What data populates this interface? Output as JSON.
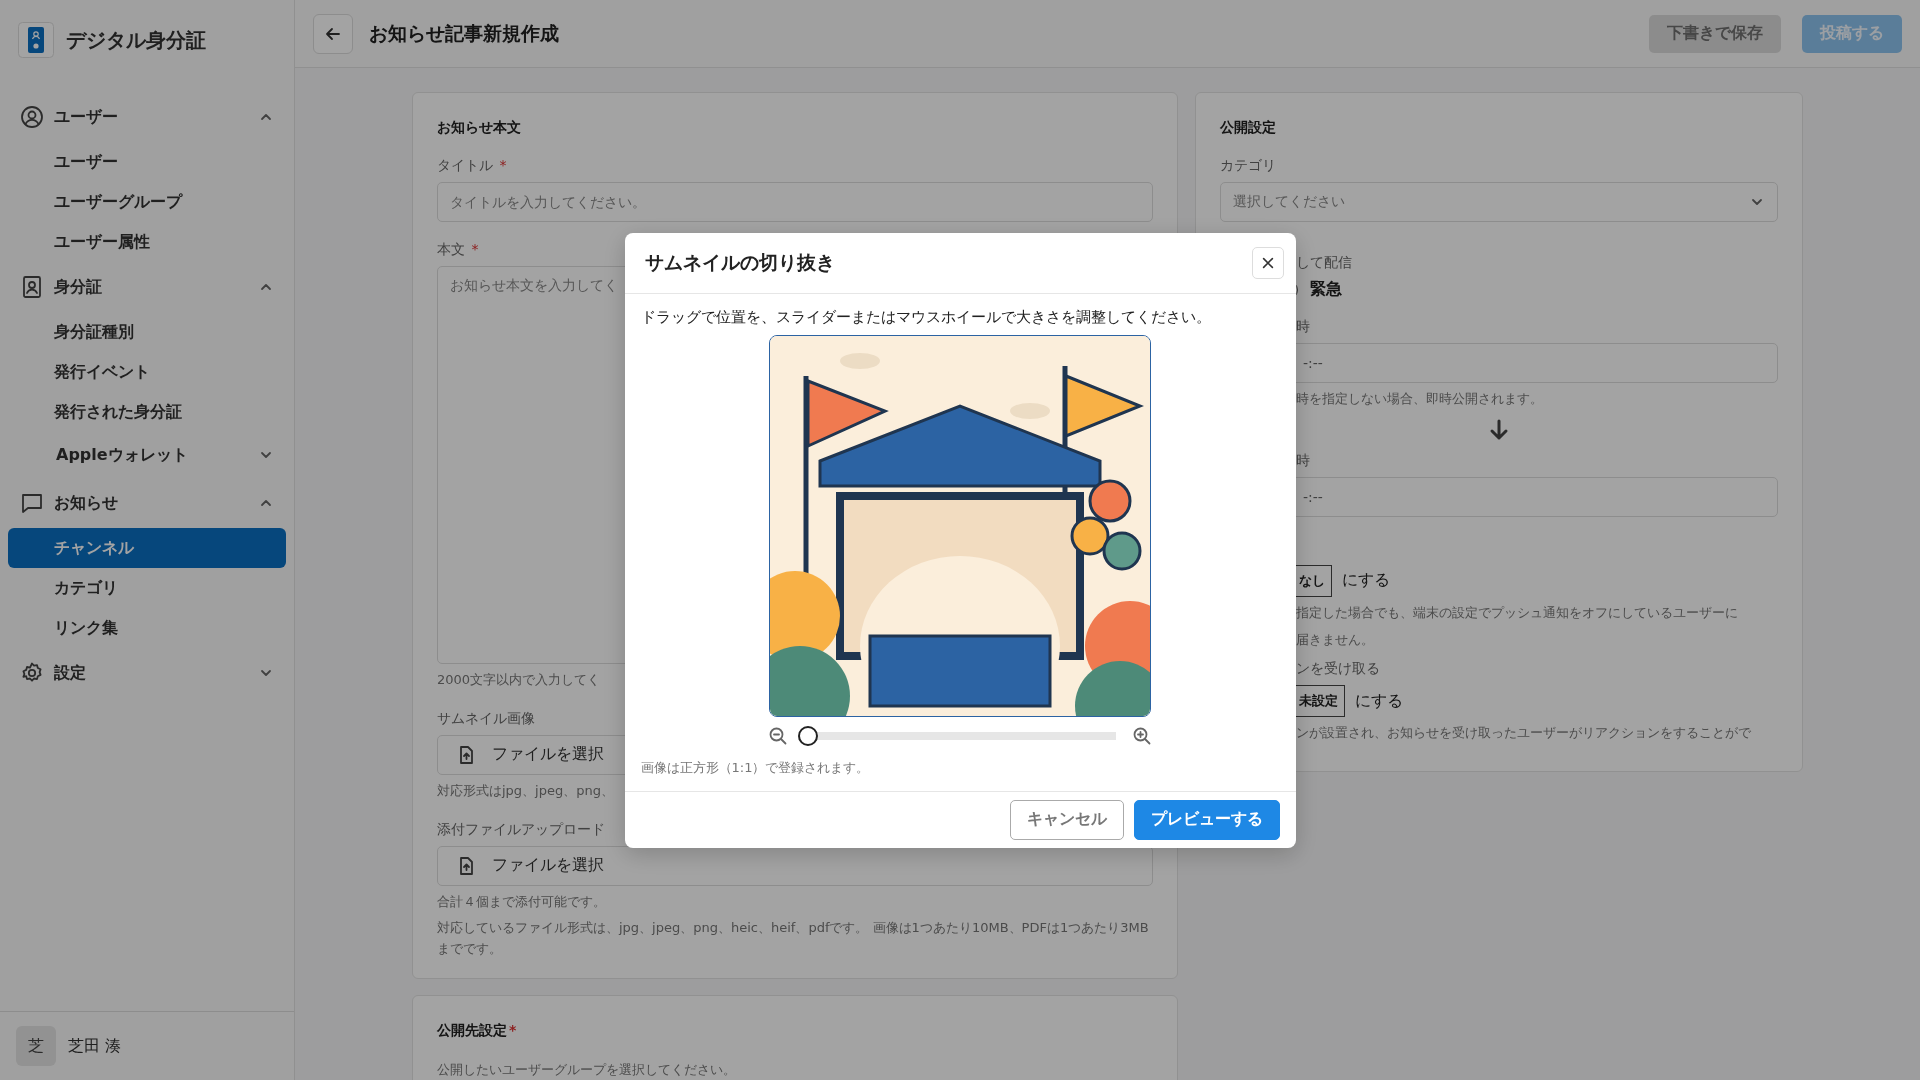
{
  "sidebar": {
    "app_name": "デジタル身分証",
    "groups": [
      {
        "label": "ユーザー",
        "expanded": true,
        "children": [
          {
            "label": "ユーザー",
            "kind": "link",
            "selected": false
          },
          {
            "label": "ユーザーグループ",
            "kind": "link",
            "selected": false
          },
          {
            "label": "ユーザー属性",
            "kind": "link",
            "selected": false
          }
        ]
      },
      {
        "label": "身分証",
        "expanded": true,
        "children": [
          {
            "label": "身分証種別",
            "kind": "link",
            "selected": false
          },
          {
            "label": "発行イベント",
            "kind": "link",
            "selected": false
          },
          {
            "label": "発行された身分証",
            "kind": "link",
            "selected": false
          },
          {
            "label": "Appleウォレット",
            "kind": "submenu",
            "selected": false,
            "expanded": false
          }
        ]
      },
      {
        "label": "お知らせ",
        "expanded": true,
        "children": [
          {
            "label": "チャンネル",
            "kind": "link",
            "selected": true
          },
          {
            "label": "カテゴリ",
            "kind": "link",
            "selected": false
          },
          {
            "label": "リンク集",
            "kind": "link",
            "selected": false
          }
        ]
      },
      {
        "label": "設定",
        "expanded": false
      }
    ],
    "user": {
      "avatar": "芝",
      "name": "芝田 湊"
    }
  },
  "header": {
    "title": "お知らせ記事新規作成",
    "buttons": [
      {
        "label": "下書きで保存",
        "kind": "secondary",
        "disabled": true
      },
      {
        "label": "投稿する",
        "kind": "primary",
        "disabled": true
      }
    ]
  },
  "body_card": {
    "heading": "お知らせ本文",
    "fields": [
      {
        "kind": "input",
        "label": "タイトル",
        "required_mark": "*",
        "placeholder": "タイトルを入力してください。"
      },
      {
        "kind": "textarea",
        "label": "本文",
        "required_mark": "*",
        "placeholder": "お知らせ本文を入力してく",
        "hints": [
          "2000文字以内で入力してく"
        ]
      },
      {
        "kind": "file",
        "label": "サムネイル画像",
        "button": "ファイルを選択",
        "hints": [
          "対応形式はjpg、jpeg、png、"
        ]
      },
      {
        "kind": "file",
        "label": "添付ファイルアップロード",
        "button": "ファイルを選択",
        "hints": [
          "合計４個まで添付可能です。",
          "対応しているファイル形式は、jpg、jpeg、png、heic、heif、pdfです。 画像は1つあたり10MB、PDFは1つあたり3MBまでです。"
        ]
      }
    ]
  },
  "audience_card": {
    "heading": "公開先設定",
    "required_mark": "*",
    "description": "公開したいユーザーグループを選択してください。"
  },
  "publish_card": {
    "heading": "公開設定",
    "category": {
      "label": "カテゴリ",
      "placeholder": "選択してください"
    },
    "rows": [
      {
        "kind": "label",
        "text": "して配信"
      },
      {
        "kind": "radio",
        "label": "緊急",
        "selected": false
      },
      {
        "kind": "label",
        "text": "時"
      },
      {
        "kind": "field",
        "value": "-:--"
      },
      {
        "kind": "hint",
        "text": "時を指定しない場合、即時公開されます。"
      },
      {
        "kind": "arrow"
      },
      {
        "kind": "label",
        "text": "時"
      },
      {
        "kind": "field",
        "value": "-:--"
      },
      {
        "kind": "toggle",
        "option": "なし",
        "suffix": "にする"
      },
      {
        "kind": "hint",
        "text": "指定した場合でも、端末の設定でプッシュ通知をオフにしているユーザーに"
      },
      {
        "kind": "hint",
        "text": "届きません。"
      },
      {
        "kind": "label",
        "text": "ンを受け取る"
      },
      {
        "kind": "toggle",
        "option": "未設定",
        "suffix": "にする"
      },
      {
        "kind": "hint",
        "text": "ンが設置され、お知らせを受け取ったユーザーがリアクションをすることがで"
      }
    ]
  },
  "modal": {
    "title": "サムネイルの切り抜き",
    "instruction": "ドラッグで位置を、スライダーまたはマウスホイールで大きさを調整してください。",
    "zoom": {
      "level": 0
    },
    "note": "画像は正方形（1:1）で登録されます。",
    "buttons": [
      {
        "label": "キャンセル",
        "kind": "secondary"
      },
      {
        "label": "プレビューする",
        "kind": "primary"
      }
    ]
  }
}
